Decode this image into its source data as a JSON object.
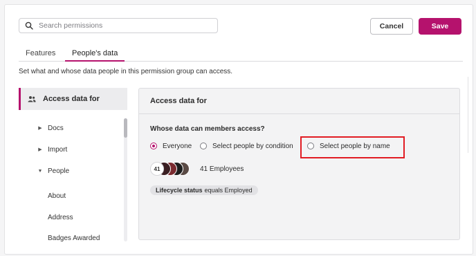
{
  "search": {
    "placeholder": "Search permissions"
  },
  "toolbar": {
    "cancel_label": "Cancel",
    "save_label": "Save"
  },
  "tabs": [
    {
      "label": "Features"
    },
    {
      "label": "People's data",
      "active": true
    }
  ],
  "description": "Set what and whose data people in this permission group can access.",
  "left_panel": {
    "header": "Access data for",
    "items": [
      {
        "label": "Docs",
        "chevron": "right"
      },
      {
        "label": "Import",
        "chevron": "right"
      },
      {
        "label": "People",
        "chevron": "down"
      }
    ],
    "sub_items": [
      "About",
      "Address",
      "Badges Awarded"
    ]
  },
  "right_panel": {
    "title": "Access data for",
    "question": "Whose data can members access?",
    "options": [
      {
        "label": "Everyone",
        "selected": true
      },
      {
        "label": "Select people by condition",
        "selected": false
      },
      {
        "label": "Select people by name",
        "selected": false
      }
    ],
    "avatars": {
      "count_label": "41",
      "colors": [
        "#3a1e22",
        "#7a2a2f",
        "#1d1d1d",
        "#5a4a45"
      ]
    },
    "employees": "41 Employees",
    "condition": {
      "field": "Lifecycle status",
      "rest": "equals Employed"
    }
  },
  "colors": {
    "accent": "#b5126d",
    "highlight": "#e11b22"
  }
}
